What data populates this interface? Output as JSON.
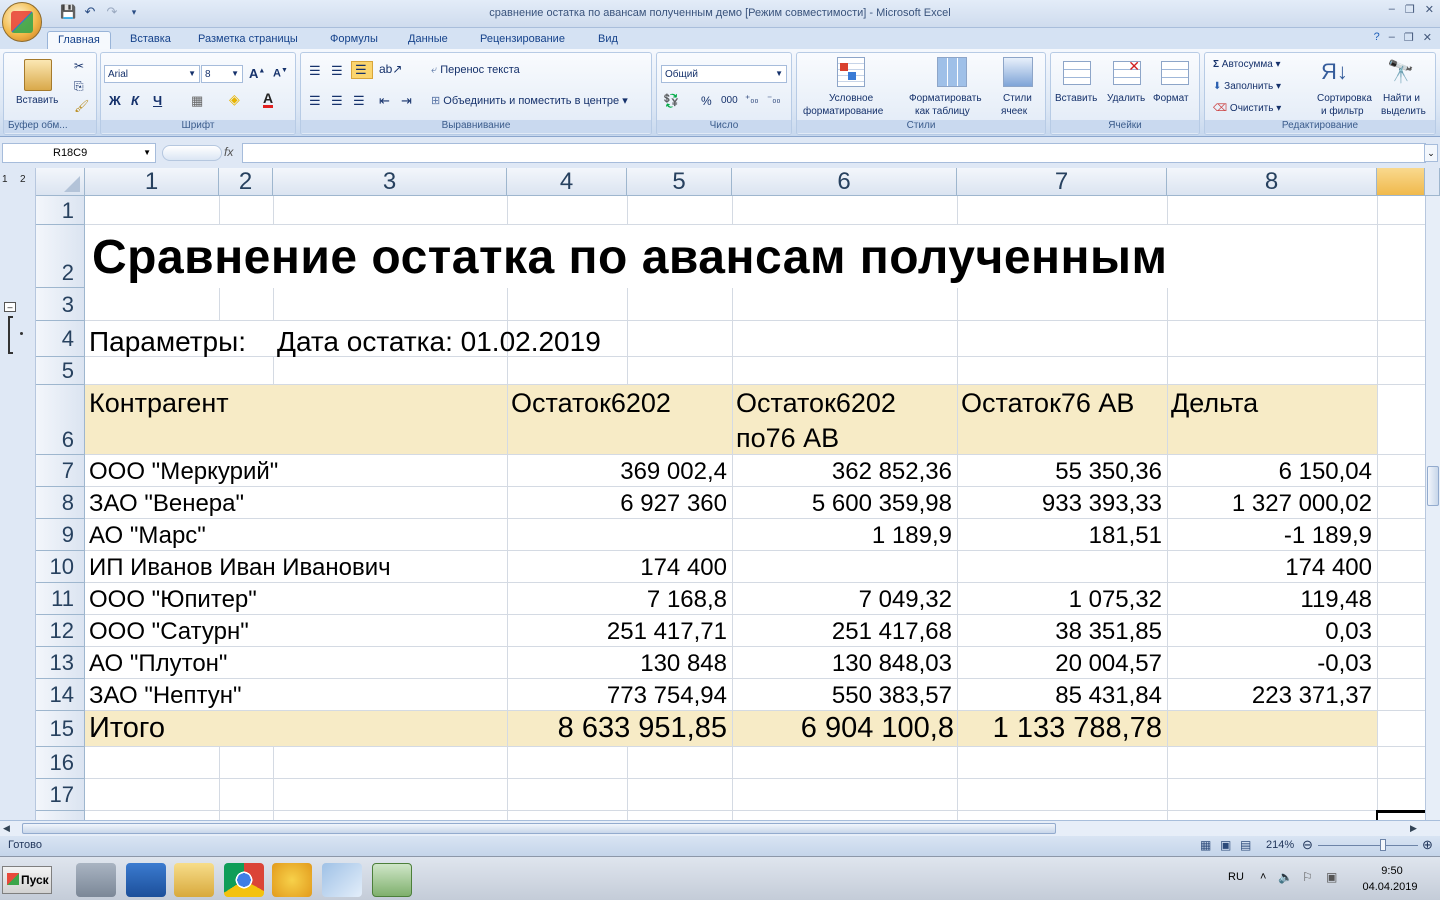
{
  "window": {
    "title": "сравнение остатка по авансам полученным демо  [Режим совместимости] - Microsoft Excel",
    "minimize": "–",
    "restore": "❐",
    "close": "✕"
  },
  "ribbon_tabs": [
    "Главная",
    "Вставка",
    "Разметка страницы",
    "Формулы",
    "Данные",
    "Рецензирование",
    "Вид"
  ],
  "ribbon": {
    "clipboard": {
      "paste": "Вставить",
      "label": "Буфер обм..."
    },
    "font": {
      "name": "Arial",
      "size": "8",
      "bold": "Ж",
      "italic": "К",
      "underline": "Ч",
      "label": "Шрифт"
    },
    "alignment": {
      "wrap": "Перенос текста",
      "merge": "Объединить и поместить в центре",
      "label": "Выравнивание"
    },
    "number": {
      "format": "Общий",
      "percent": "%",
      "thousands": "000",
      "label": "Число"
    },
    "styles": {
      "conditional_1": "Условное",
      "conditional_2": "форматирование",
      "as_table_1": "Форматировать",
      "as_table_2": "как таблицу",
      "cell_styles_1": "Стили",
      "cell_styles_2": "ячеек",
      "label": "Стили"
    },
    "cells": {
      "insert": "Вставить",
      "delete": "Удалить",
      "format": "Формат",
      "label": "Ячейки"
    },
    "editing": {
      "autosum": "Автосумма",
      "fill": "Заполнить",
      "clear": "Очистить",
      "sort_1": "Сортировка",
      "sort_2": "и фильтр",
      "find_1": "Найти и",
      "find_2": "выделить",
      "label": "Редактирование"
    }
  },
  "formula_bar": {
    "name_box": "R18C9",
    "fx": "fx",
    "value": ""
  },
  "outline_levels": [
    "1",
    "2"
  ],
  "columns": [
    "1",
    "2",
    "3",
    "4",
    "5",
    "6",
    "7",
    "8"
  ],
  "rows": [
    "1",
    "2",
    "3",
    "4",
    "5",
    "6",
    "7",
    "8",
    "9",
    "10",
    "11",
    "12",
    "13",
    "14",
    "15",
    "16",
    "17"
  ],
  "sheet": {
    "title": "Сравнение остатка по авансам полученным",
    "params_label": "Параметры:",
    "params_value": "Дата остатка: 01.02.2019",
    "headers": [
      "Контрагент",
      "Остаток6202",
      "Остаток6202",
      "по76 АВ",
      "Остаток76 АВ",
      "Дельта"
    ],
    "data": [
      [
        "ООО \"Меркурий\"",
        "369 002,4",
        "362 852,36",
        "55 350,36",
        "6 150,04"
      ],
      [
        "ЗАО \"Венера\"",
        "6 927 360",
        "5 600 359,98",
        "933 393,33",
        "1 327 000,02"
      ],
      [
        "АО \"Марс\"",
        "",
        "1 189,9",
        "181,51",
        "-1 189,9"
      ],
      [
        "ИП Иванов Иван Иванович",
        "174 400",
        "",
        "",
        "174 400"
      ],
      [
        "ООО \"Юпитер\"",
        "7 168,8",
        "7 049,32",
        "1 075,32",
        "119,48"
      ],
      [
        "ООО \"Сатурн\"",
        "251 417,71",
        "251 417,68",
        "38 351,85",
        "0,03"
      ],
      [
        "АО \"Плутон\"",
        "130 848",
        "130 848,03",
        "20 004,57",
        "-0,03"
      ],
      [
        "ЗАО \"Нептун\"",
        "773 754,94",
        "550 383,57",
        "85 431,84",
        "223 371,37"
      ]
    ],
    "total": [
      "Итого",
      "8 633 951,85",
      "6 904 100,8",
      "1 133 788,78"
    ]
  },
  "status": {
    "ready": "Готово",
    "zoom": "214%"
  },
  "taskbar": {
    "start": "Пуск",
    "lang": "RU",
    "time": "9:50",
    "date": "04.04.2019"
  },
  "colors": {
    "header_band": "#f7ebc6",
    "ribbon_text": "#15428b"
  }
}
